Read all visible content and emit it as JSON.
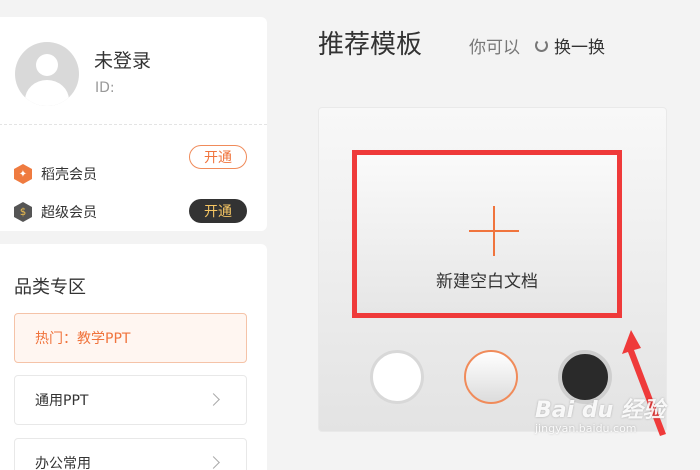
{
  "user": {
    "name": "未登录",
    "id_label": "ID:"
  },
  "vip": [
    {
      "label": "稻壳会员",
      "button": "开通",
      "icon": "daoke-hexagon-icon",
      "color": "#ef7b40"
    },
    {
      "label": "超级会员",
      "button": "开通",
      "icon": "super-vip-hexagon-icon",
      "color": "#555555"
    }
  ],
  "category": {
    "title": "品类专区",
    "items": [
      {
        "label": "热门：教学PPT",
        "active": true
      },
      {
        "label": "通用PPT",
        "active": false
      },
      {
        "label": "办公常用",
        "active": false
      }
    ]
  },
  "templates": {
    "title": "推荐模板",
    "hint": "你可以",
    "refresh_label": "换一换",
    "new_blank": "新建空白文档",
    "swatches": [
      "white",
      "light-gray",
      "black"
    ]
  },
  "watermark": {
    "brand": "Bai du 经验",
    "url": "jingyan.baidu.com"
  },
  "colors": {
    "accent": "#f0743d",
    "highlight_box": "#ef3a3a",
    "arrow": "#ef3a3a"
  }
}
